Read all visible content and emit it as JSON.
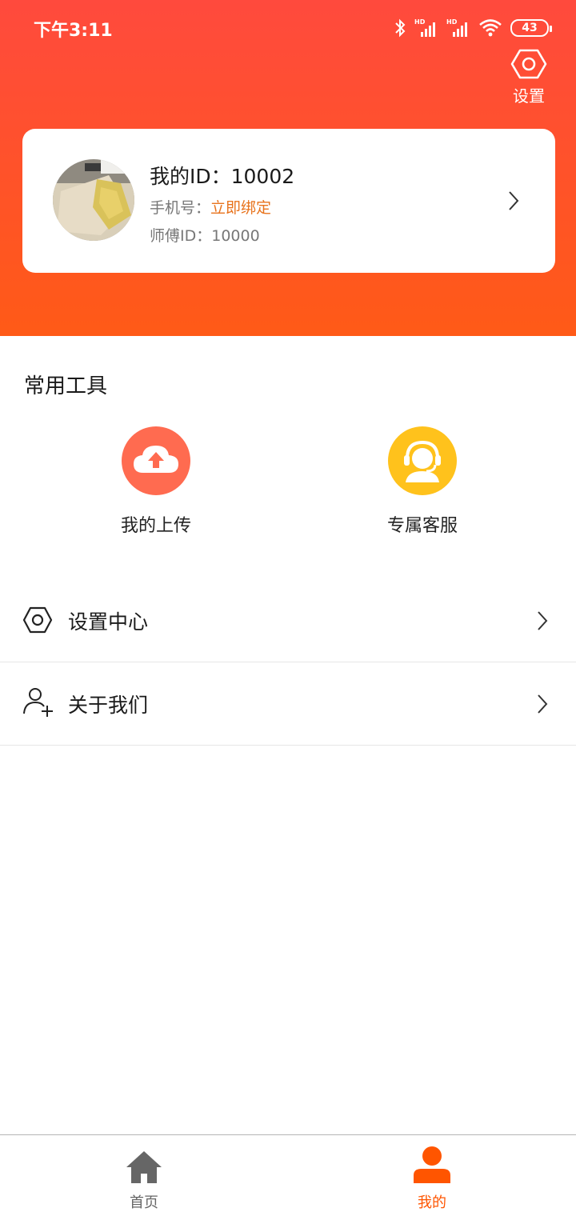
{
  "status_bar": {
    "time": "下午3:11",
    "battery": "43"
  },
  "header": {
    "settings_label": "设置"
  },
  "profile": {
    "id_text": "我的ID：10002",
    "phone_label": "手机号：",
    "phone_action": "立即绑定",
    "master_text": "师傅ID：10000"
  },
  "tools": {
    "title": "常用工具",
    "items": [
      {
        "label": "我的上传",
        "icon": "cloud-upload-icon",
        "color": "#ff6b50"
      },
      {
        "label": "专属客服",
        "icon": "customer-service-icon",
        "color": "#ffc21c"
      }
    ]
  },
  "menu": {
    "items": [
      {
        "label": "设置中心",
        "icon": "hexagon-settings-icon"
      },
      {
        "label": "关于我们",
        "icon": "user-add-icon"
      }
    ]
  },
  "bottom_nav": {
    "items": [
      {
        "label": "首页",
        "icon": "home-icon",
        "active": false
      },
      {
        "label": "我的",
        "icon": "person-icon",
        "active": true
      }
    ],
    "active_color": "#ff5500",
    "inactive_color": "#666666"
  },
  "colors": {
    "header_top": "#ff4a3d",
    "header_bottom": "#ff5a17",
    "accent": "#e8731c"
  }
}
